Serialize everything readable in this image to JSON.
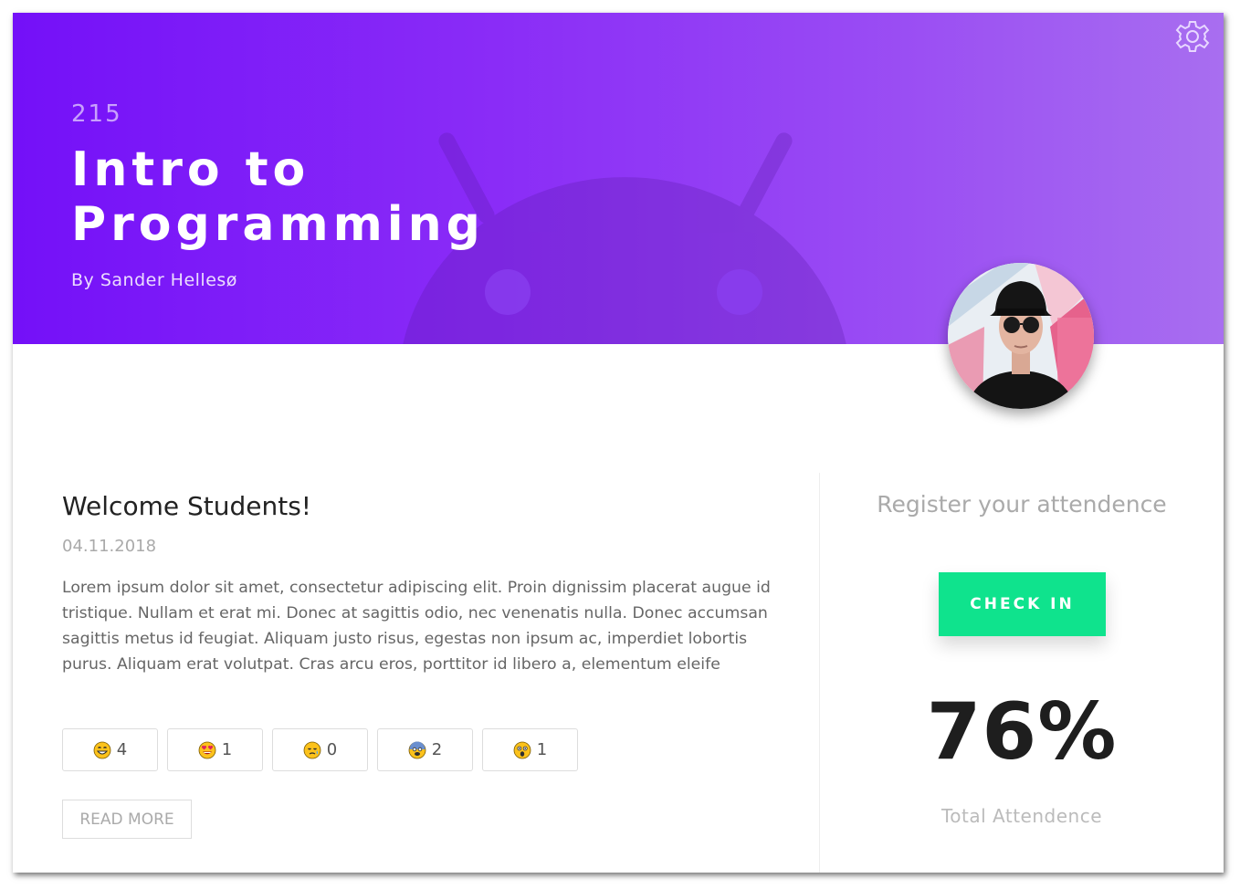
{
  "header": {
    "course_code": "215",
    "course_title": "Intro to\nProgramming",
    "author": "By Sander Hellesø",
    "settings_icon": "gear-icon",
    "gradient": [
      "#7410f8",
      "#a86ef0"
    ]
  },
  "post": {
    "title": "Welcome Students!",
    "date": "04.11.2018",
    "body": "Lorem ipsum dolor sit amet, consectetur adipiscing elit. Proin dignissim placerat augue id tristique. Nullam et erat mi. Donec at sagittis odio, nec venenatis nulla. Donec accumsan sagittis metus id feugiat. Aliquam justo risus, egestas non ipsum ac, imperdiet lobortis purus. Aliquam erat volutpat. Cras arcu eros, porttitor id libero a, elementum eleife",
    "reactions": [
      {
        "icon": "grinning-face-icon",
        "count": "4"
      },
      {
        "icon": "heart-eyes-face-icon",
        "count": "1"
      },
      {
        "icon": "disappointed-relieved-face-icon",
        "count": "0"
      },
      {
        "icon": "fearful-face-icon",
        "count": "2"
      },
      {
        "icon": "astonished-face-icon",
        "count": "1"
      }
    ],
    "read_more_label": "READ MORE"
  },
  "attendance": {
    "heading": "Register your attendence",
    "checkin_label": "CHECK IN",
    "value": "76%",
    "label": "Total Attendence",
    "accent": "#0fe38d"
  }
}
